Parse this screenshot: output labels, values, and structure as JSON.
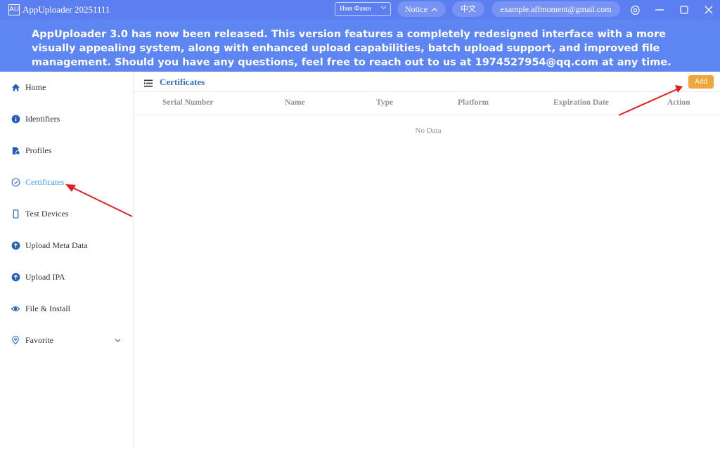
{
  "titlebar": {
    "logo": "AU",
    "title": "AppUploader 20251111",
    "user_select": "Имя Фамн",
    "notice": "Notice",
    "language": "中文",
    "email": "example.affmoment@gmail.com"
  },
  "banner": {
    "text": "AppUploader 3.0 has now been released. This version features a completely redesigned interface with a more visually appealing system, along with enhanced upload capabilities, batch upload support, and improved file management. Should you have any questions, feel free to reach out to us at 1974527954@qq.com at any time."
  },
  "sidebar": {
    "items": [
      {
        "label": "Home",
        "icon": "home-icon"
      },
      {
        "label": "Identifiers",
        "icon": "info-icon"
      },
      {
        "label": "Profiles",
        "icon": "profile-icon"
      },
      {
        "label": "Certificates",
        "icon": "check-circle-icon",
        "active": true
      },
      {
        "label": "Test Devices",
        "icon": "phone-icon"
      },
      {
        "label": "Upload Meta Data",
        "icon": "upload-icon"
      },
      {
        "label": "Upload IPA",
        "icon": "upload-icon"
      },
      {
        "label": "File & Install",
        "icon": "eye-icon"
      },
      {
        "label": "Favorite",
        "icon": "pin-icon"
      }
    ]
  },
  "main": {
    "title": "Certificates",
    "add_label": "Add",
    "columns": [
      "Serial Number",
      "Name",
      "Type",
      "Platform",
      "Expiration Date",
      "Action"
    ],
    "empty_text": "No Data"
  },
  "colors": {
    "titlebar": "#5b7ef0",
    "banner": "#5e86f2",
    "active": "#409eff",
    "add_button": "#f0a63a",
    "annotation_arrow": "#e02020"
  }
}
